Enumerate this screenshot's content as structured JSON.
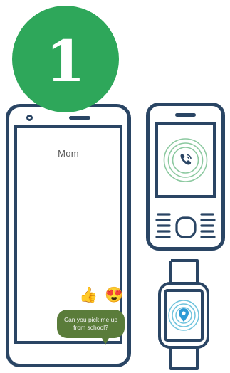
{
  "step_badge": {
    "number": "1"
  },
  "smartphone": {
    "contact_name": "Mom",
    "reactions": [
      "👍",
      "😍"
    ],
    "message": "Can you pick me up from school?"
  },
  "feature_phone": {
    "screen_icon": "phone-call-icon"
  },
  "smartwatch": {
    "screen_icon": "location-pin-icon"
  },
  "colors": {
    "badge": "#2ea75a",
    "outline": "#2a4564",
    "bubble": "#5a7c3a",
    "signal_ring": "#8cc9a0",
    "watch_ring": "#6fc3dd",
    "watch_pin": "#2e9bd6"
  }
}
